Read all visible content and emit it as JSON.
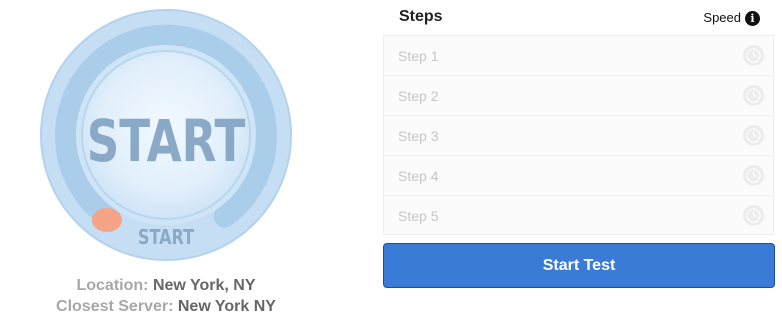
{
  "gauge": {
    "center_label": "START",
    "bottom_label": "START"
  },
  "location": {
    "label": "Location:",
    "value": "New York, NY"
  },
  "server": {
    "label": "Closest Server:",
    "value": "New York NY"
  },
  "steps_panel": {
    "title": "Steps",
    "speed_label": "Speed",
    "info_glyph": "i",
    "steps": [
      {
        "label": "Step 1",
        "icon": "clock-icon"
      },
      {
        "label": "Step 2",
        "icon": "clock-icon"
      },
      {
        "label": "Step 3",
        "icon": "clock-icon"
      },
      {
        "label": "Step 4",
        "icon": "clock-icon"
      },
      {
        "label": "Step 5",
        "icon": "clock-icon"
      }
    ]
  },
  "start_test_button": {
    "label": "Start Test",
    "color": "#3a7bd8"
  },
  "colors": {
    "gauge_outer": "#c2dcf2",
    "gauge_track": "#a9cde9",
    "gauge_inner": "#ddeefa",
    "needle": "#f4a487",
    "gauge_text": "#8aa9c6"
  }
}
